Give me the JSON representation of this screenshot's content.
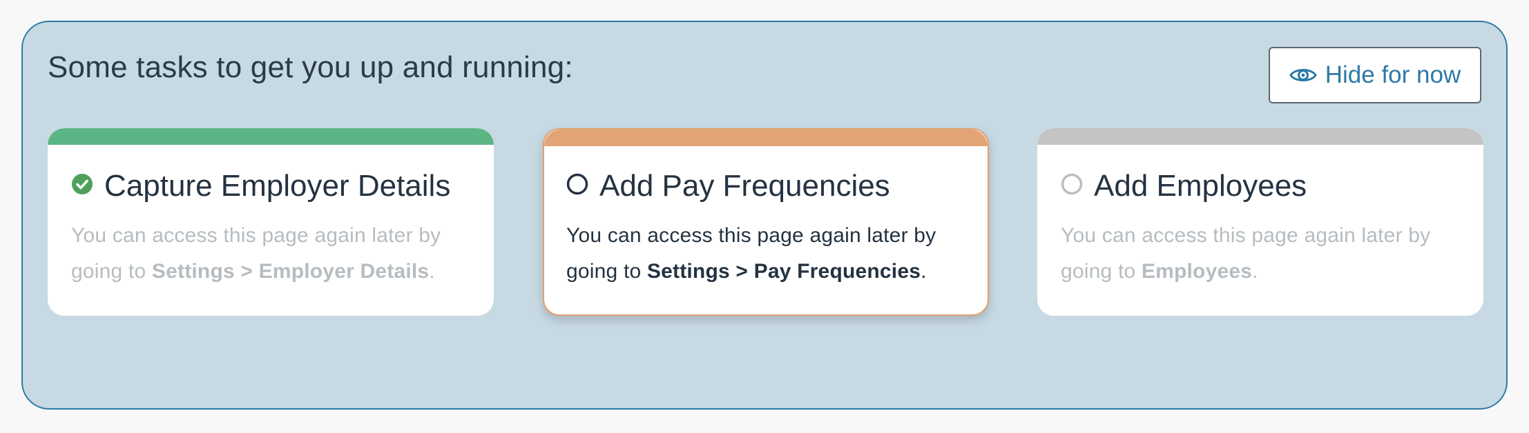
{
  "panel": {
    "heading": "Some tasks to get you up and running:",
    "hide_button": {
      "label": "Hide for now",
      "icon": "eye-icon"
    }
  },
  "tasks": [
    {
      "title": "Capture Employer Details",
      "status": "complete",
      "icon": "check-circle-icon",
      "accent_color": "#5cb585",
      "desc_prefix": "You can access this page again later by going to ",
      "desc_link": "Settings > Employer Details",
      "desc_suffix": "."
    },
    {
      "title": "Add Pay Frequencies",
      "status": "current",
      "icon": "empty-circle-icon",
      "accent_color": "#e3a475",
      "desc_prefix": "You can access this page again later by going to ",
      "desc_link": "Settings > Pay Frequencies",
      "desc_suffix": "."
    },
    {
      "title": "Add Employees",
      "status": "pending",
      "icon": "empty-circle-icon",
      "accent_color": "#c4c4c4",
      "desc_prefix": "You can access this page again later by going to ",
      "desc_link": "Employees",
      "desc_suffix": "."
    }
  ]
}
